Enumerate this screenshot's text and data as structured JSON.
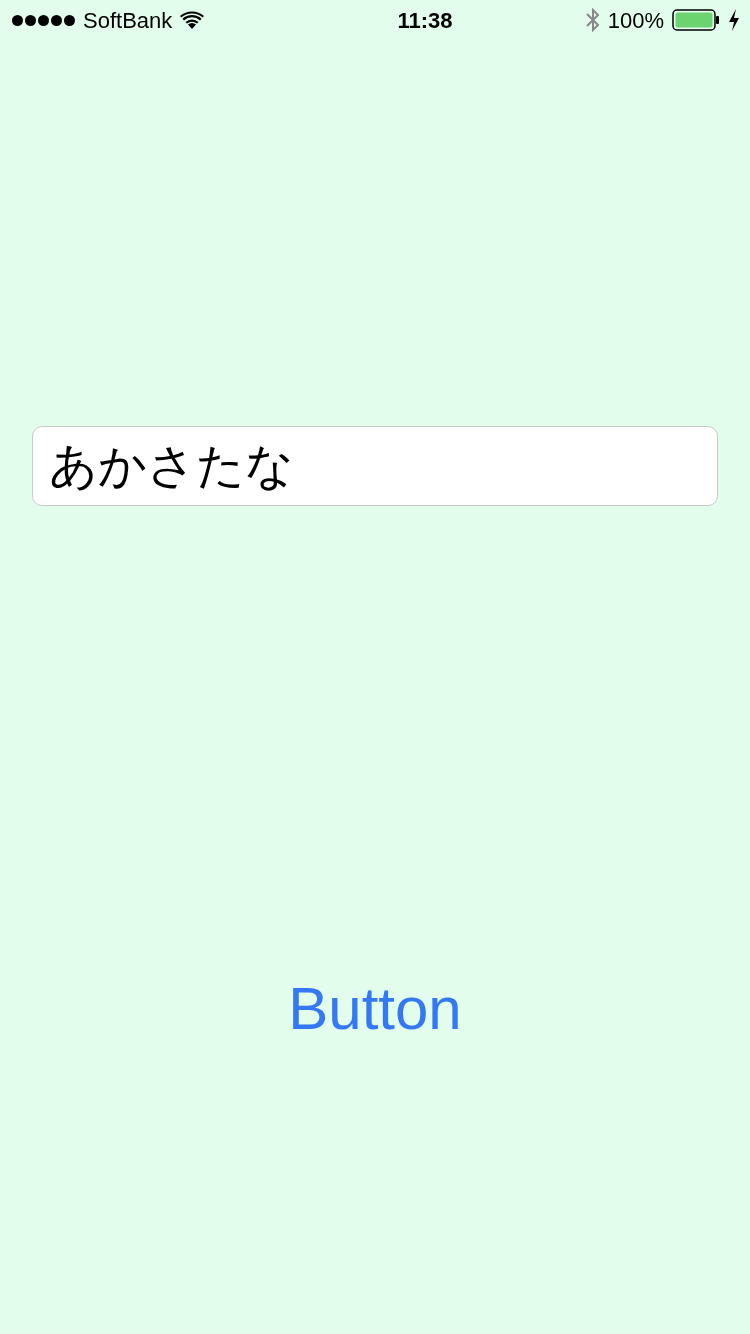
{
  "status_bar": {
    "carrier": "SoftBank",
    "time": "11:38",
    "battery_percent": "100%",
    "charging": true
  },
  "text_field": {
    "value": "あかさたな"
  },
  "button": {
    "label": "Button"
  }
}
